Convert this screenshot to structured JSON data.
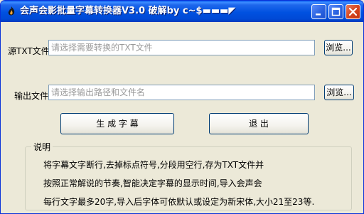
{
  "window": {
    "title": "会声会影批量字幕转换器V3.0 破解by c~$▬▬▬◤",
    "icons": {
      "app": "flame-app-icon",
      "minimize": "minimize-icon",
      "maximize": "maximize-icon",
      "close": "close-icon"
    }
  },
  "source": {
    "label": "源TXT文件",
    "placeholder": "请选择需要转换的TXT文件",
    "browse_label": "浏览..."
  },
  "output": {
    "label": "输出文件",
    "placeholder": "请选择输出路径和文件名",
    "browse_label": "浏览..."
  },
  "actions": {
    "generate_label": "生 成 字 幕",
    "exit_label": "退  出"
  },
  "help": {
    "title": "说明",
    "lines": [
      "将字幕文字断行,去掉标点符号,分段用空行,存为TXT文件并",
      "按照正常解说的节奏,智能决定字幕的显示时间,导入会声会",
      "每行文字最多20字,导入后字体可依默认或设定为新宋体,大小21至23等."
    ]
  }
}
